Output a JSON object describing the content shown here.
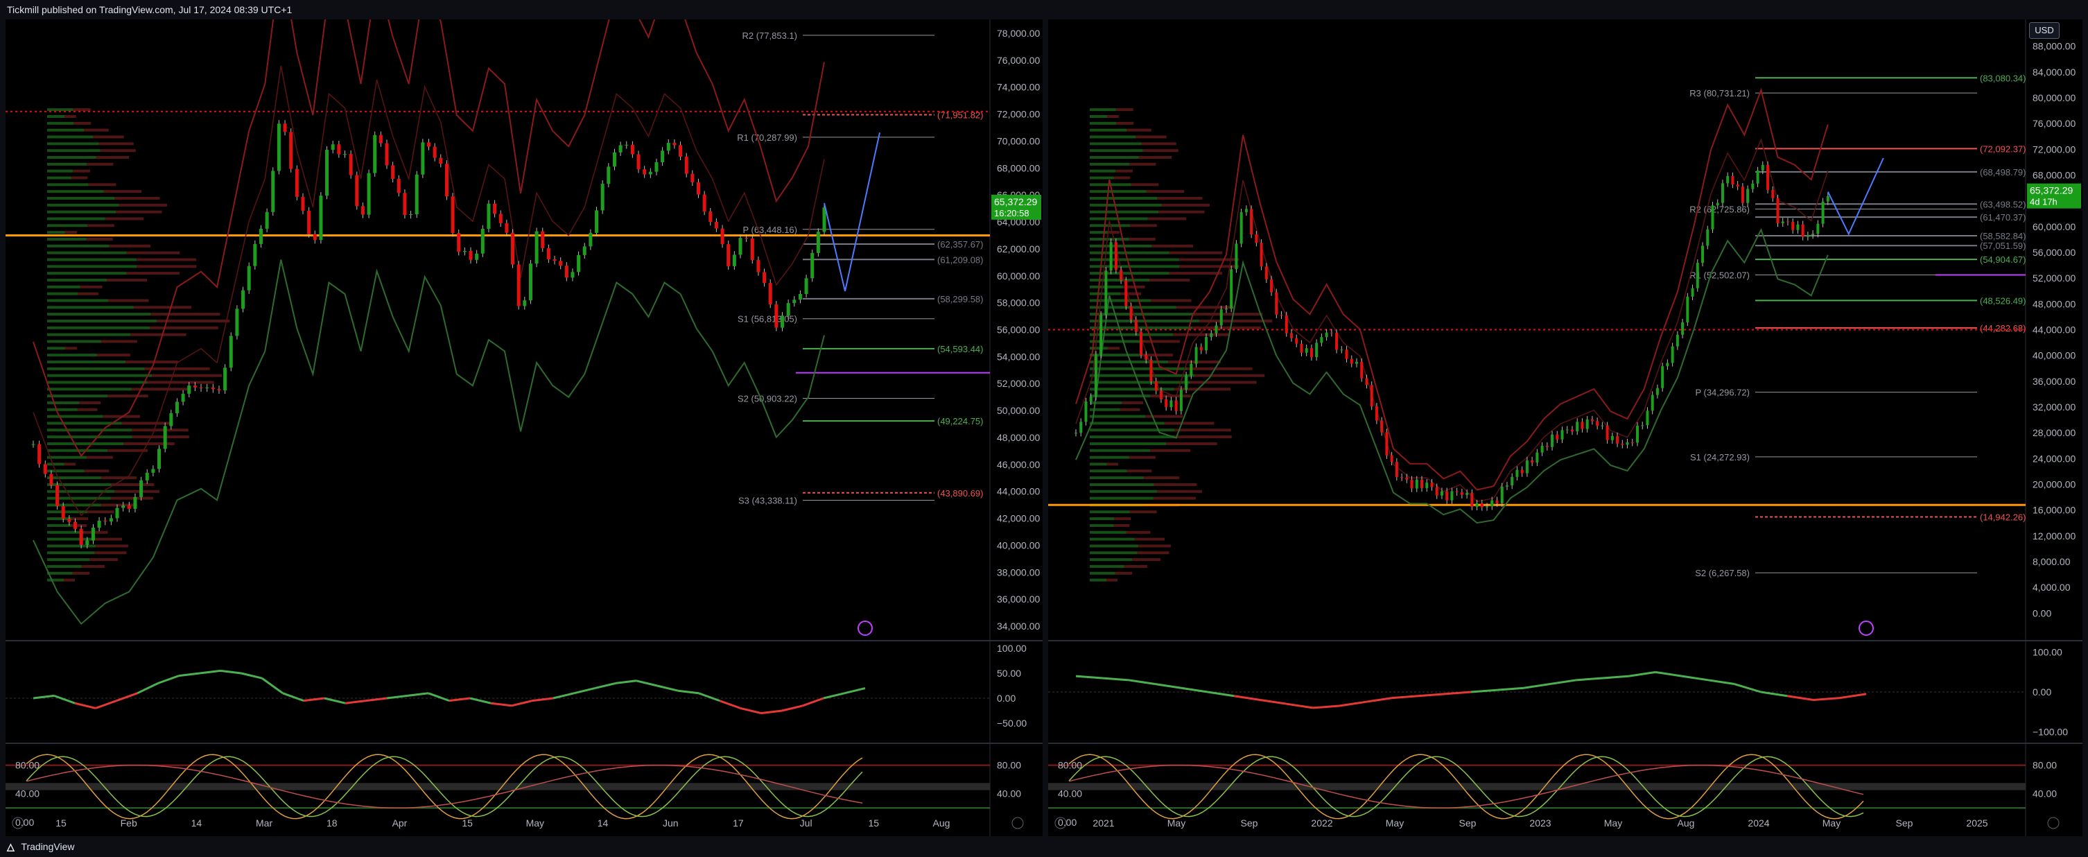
{
  "header": {
    "published": "Tickmill published on TradingView.com, Jul 17, 2024 08:39 UTC+1"
  },
  "footer": {
    "brand": "TradingView"
  },
  "currency": "USD",
  "colors": {
    "up": "#26a69a",
    "down": "#ef5350",
    "green": "#1e9e1e",
    "red": "#e31010",
    "orange": "#ff9800",
    "magenta": "#c040ff",
    "blue": "#4d7bff"
  },
  "chart_data": [
    {
      "type": "candlestick",
      "panel": "left",
      "x_ticks": [
        "15",
        "Feb",
        "14",
        "Mar",
        "18",
        "Apr",
        "15",
        "May",
        "14",
        "Jun",
        "17",
        "Jul",
        "15",
        "Aug"
      ],
      "y_ticks": [
        "34,000.00",
        "36,000.00",
        "38,000.00",
        "40,000.00",
        "42,000.00",
        "44,000.00",
        "46,000.00",
        "48,000.00",
        "50,000.00",
        "52,000.00",
        "54,000.00",
        "56,000.00",
        "58,000.00",
        "60,000.00",
        "62,000.00",
        "64,000.00",
        "66,000.00",
        "68,000.00",
        "70,000.00",
        "72,000.00",
        "74,000.00",
        "76,000.00",
        "78,000.00"
      ],
      "ylim": [
        34000,
        78000
      ],
      "last_price": {
        "value": "65,372.29",
        "countdown": "16:20:58"
      },
      "levels": [
        {
          "label": "R2 (77,853.1)",
          "value": 77853.1,
          "color": "#9598a1"
        },
        {
          "label": "(71,951.82)",
          "value": 71951.82,
          "color": "#ef5350"
        },
        {
          "label": "R1 (70,287.99)",
          "value": 70287.99,
          "color": "#9598a1"
        },
        {
          "label": "P (63,448.16)",
          "value": 63448.16,
          "color": "#9598a1"
        },
        {
          "label": "(62,357.67)",
          "value": 62357.67,
          "color": "#787b86"
        },
        {
          "label": "(61,209.08)",
          "value": 61209.08,
          "color": "#787b86"
        },
        {
          "label": "(58,299.58)",
          "value": 58299.58,
          "color": "#787b86"
        },
        {
          "label": "S1 (56,813.05)",
          "value": 56813.05,
          "color": "#9598a1"
        },
        {
          "label": "(54,593.44)",
          "value": 54593.44,
          "color": "#4caf50"
        },
        {
          "label": "S2 (50,903.22)",
          "value": 50903.22,
          "color": "#9598a1"
        },
        {
          "label": "(49,224.75)",
          "value": 49224.75,
          "color": "#4caf50"
        },
        {
          "label": "(43,890.69)",
          "value": 43890.69,
          "color": "#ef5350"
        },
        {
          "label": "S3 (43,338.11)",
          "value": 43338.11,
          "color": "#9598a1"
        }
      ],
      "path": [
        [
          0,
          47500
        ],
        [
          6,
          43000
        ],
        [
          12,
          40200
        ],
        [
          18,
          42000
        ],
        [
          24,
          43000
        ],
        [
          30,
          46000
        ],
        [
          36,
          51000
        ],
        [
          42,
          52000
        ],
        [
          46,
          51000
        ],
        [
          50,
          56000
        ],
        [
          54,
          61000
        ],
        [
          58,
          64000
        ],
        [
          62,
          72000
        ],
        [
          66,
          66000
        ],
        [
          70,
          62000
        ],
        [
          74,
          70000
        ],
        [
          78,
          69000
        ],
        [
          82,
          64000
        ],
        [
          86,
          71000
        ],
        [
          90,
          67000
        ],
        [
          94,
          64000
        ],
        [
          98,
          70500
        ],
        [
          102,
          68000
        ],
        [
          106,
          62000
        ],
        [
          110,
          61000
        ],
        [
          114,
          65000
        ],
        [
          118,
          64000
        ],
        [
          122,
          57000
        ],
        [
          126,
          63000
        ],
        [
          130,
          61000
        ],
        [
          134,
          60000
        ],
        [
          138,
          62000
        ],
        [
          142,
          66000
        ],
        [
          146,
          70000
        ],
        [
          150,
          69000
        ],
        [
          154,
          67000
        ],
        [
          158,
          70000
        ],
        [
          162,
          69000
        ],
        [
          166,
          66000
        ],
        [
          170,
          64000
        ],
        [
          174,
          61000
        ],
        [
          178,
          63000
        ],
        [
          182,
          60000
        ],
        [
          186,
          56500
        ],
        [
          190,
          58000
        ],
        [
          194,
          60000
        ],
        [
          198,
          65400
        ]
      ],
      "x_domain": [
        0,
        236
      ],
      "rsi": {
        "ticks": [
          "100.00",
          "50.00",
          "0.00",
          "−50.00"
        ],
        "ylim": [
          -75,
          100
        ],
        "values": [
          0,
          5,
          -10,
          -20,
          -5,
          10,
          30,
          45,
          50,
          55,
          50,
          40,
          10,
          -5,
          0,
          -10,
          -5,
          0,
          5,
          10,
          -5,
          0,
          -10,
          -15,
          -5,
          0,
          10,
          20,
          30,
          35,
          25,
          15,
          10,
          -5,
          -20,
          -30,
          -25,
          -15,
          0,
          10,
          20
        ]
      },
      "stoch": {
        "ticks": [
          "80.00",
          "40.00"
        ],
        "left_ticks": [
          "80.00",
          "40.00",
          "0.00"
        ],
        "ylim": [
          -5,
          100
        ]
      }
    },
    {
      "type": "candlestick",
      "panel": "right",
      "x_ticks": [
        "2021",
        "May",
        "Sep",
        "2022",
        "May",
        "Sep",
        "2023",
        "May",
        "Aug",
        "2024",
        "May",
        "Sep",
        "2025"
      ],
      "y_ticks": [
        "0.00",
        "4,000.00",
        "8,000.00",
        "12,000.00",
        "16,000.00",
        "20,000.00",
        "24,000.00",
        "28,000.00",
        "32,000.00",
        "36,000.00",
        "40,000.00",
        "44,000.00",
        "48,000.00",
        "52,000.00",
        "56,000.00",
        "60,000.00",
        "64,000.00",
        "68,000.00",
        "72,000.00",
        "76,000.00",
        "80,000.00",
        "84,000.00",
        "88,000.00"
      ],
      "ylim": [
        -2000,
        90000
      ],
      "last_price": {
        "value": "65,372.29",
        "countdown": "4d 17h"
      },
      "levels": [
        {
          "label": "(83,080.34)",
          "value": 83080.34,
          "color": "#4caf50"
        },
        {
          "label": "R3 (80,731.21)",
          "value": 80731.21,
          "color": "#9598a1"
        },
        {
          "label": "(72,092.37)",
          "value": 72092.37,
          "color": "#ef5350"
        },
        {
          "label": "(68,498.79)",
          "value": 68498.79,
          "color": "#787b86"
        },
        {
          "label": "(63,498.52)",
          "value": 63498.52,
          "color": "#787b86"
        },
        {
          "label": "R2 (62,725.86)",
          "value": 62725.86,
          "color": "#9598a1"
        },
        {
          "label": "(61,470.37)",
          "value": 61470.37,
          "color": "#787b86"
        },
        {
          "label": "(58,582.84)",
          "value": 58582.84,
          "color": "#787b86"
        },
        {
          "label": "(57,051.59)",
          "value": 57051.59,
          "color": "#787b86"
        },
        {
          "label": "(54,904.67)",
          "value": 54904.67,
          "color": "#4caf50"
        },
        {
          "label": "R1 (52,502.07)",
          "value": 52502.07,
          "color": "#9598a1"
        },
        {
          "label": "(48,526.49)",
          "value": 48526.49,
          "color": "#4caf50"
        },
        {
          "label": "(44,282.68)",
          "value": 44282.68,
          "color": "#ef5350"
        },
        {
          "label": "P (34,296.72)",
          "value": 34296.72,
          "color": "#9598a1"
        },
        {
          "label": "S1 (24,272.93)",
          "value": 24272.93,
          "color": "#9598a1"
        },
        {
          "label": "(14,942.26)",
          "value": 14942.26,
          "color": "#ef5350"
        },
        {
          "label": "S2 (6,267.58)",
          "value": 6267.58,
          "color": "#9598a1"
        }
      ],
      "path": [
        [
          0,
          28000
        ],
        [
          4,
          35000
        ],
        [
          8,
          58000
        ],
        [
          12,
          48000
        ],
        [
          16,
          40000
        ],
        [
          20,
          33000
        ],
        [
          24,
          32000
        ],
        [
          28,
          40000
        ],
        [
          32,
          43000
        ],
        [
          36,
          48000
        ],
        [
          40,
          64000
        ],
        [
          44,
          55000
        ],
        [
          48,
          47000
        ],
        [
          52,
          42000
        ],
        [
          56,
          40000
        ],
        [
          60,
          44000
        ],
        [
          64,
          40000
        ],
        [
          68,
          38000
        ],
        [
          72,
          30000
        ],
        [
          76,
          22000
        ],
        [
          80,
          20000
        ],
        [
          84,
          20000
        ],
        [
          88,
          18000
        ],
        [
          92,
          19000
        ],
        [
          96,
          16500
        ],
        [
          100,
          17000
        ],
        [
          104,
          21000
        ],
        [
          108,
          23000
        ],
        [
          112,
          26000
        ],
        [
          116,
          28000
        ],
        [
          120,
          29000
        ],
        [
          124,
          30000
        ],
        [
          128,
          27000
        ],
        [
          132,
          26000
        ],
        [
          136,
          30000
        ],
        [
          140,
          37000
        ],
        [
          144,
          43000
        ],
        [
          148,
          52000
        ],
        [
          152,
          62000
        ],
        [
          156,
          68000
        ],
        [
          160,
          64000
        ],
        [
          164,
          70000
        ],
        [
          168,
          61000
        ],
        [
          172,
          60000
        ],
        [
          176,
          58000
        ],
        [
          180,
          65400
        ]
      ],
      "x_domain": [
        0,
        224
      ],
      "rsi": {
        "ticks": [
          "100.00",
          "0.00",
          "−100.00"
        ],
        "ylim": [
          -110,
          110
        ],
        "values": [
          40,
          35,
          30,
          20,
          10,
          0,
          -10,
          -20,
          -30,
          -40,
          -35,
          -25,
          -15,
          -10,
          -5,
          0,
          5,
          10,
          20,
          30,
          35,
          40,
          50,
          40,
          30,
          20,
          0,
          -10,
          -20,
          -15,
          -5
        ]
      },
      "stoch": {
        "ticks": [
          "80.00",
          "40.00"
        ],
        "left_ticks": [
          "80.00",
          "40.00",
          "0.00"
        ],
        "ylim": [
          -5,
          100
        ]
      }
    }
  ]
}
